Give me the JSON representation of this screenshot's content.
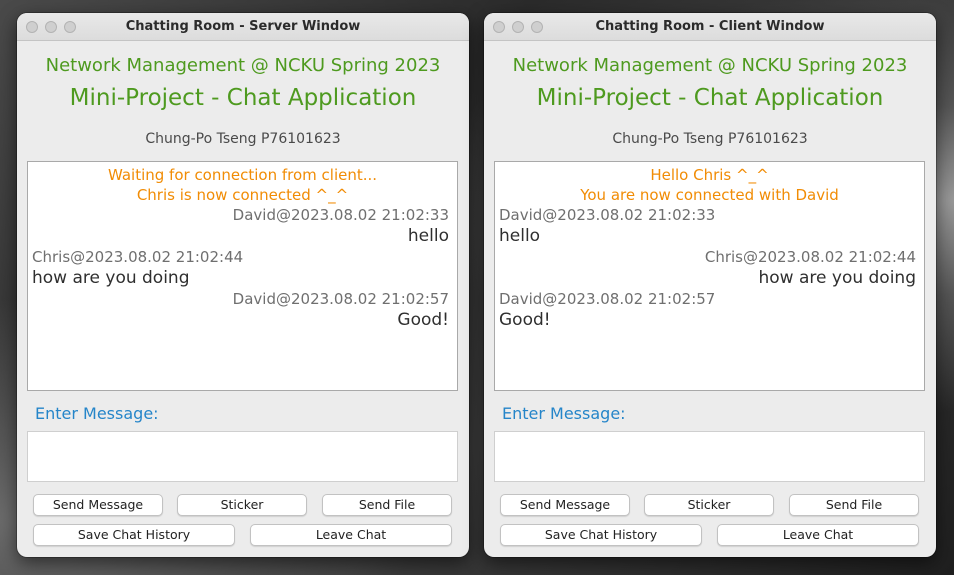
{
  "server": {
    "window_title": "Chatting Room - Server Window",
    "course": "Network Management @ NCKU Spring 2023",
    "project": "Mini-Project - Chat Application",
    "author": "Chung-Po Tseng P76101623",
    "system_messages": [
      "Waiting for connection from client...",
      "Chris is now connected ^_^"
    ],
    "messages": [
      {
        "header": "David@2023.08.02 21:02:33",
        "text": "hello"
      },
      {
        "header": "Chris@2023.08.02 21:02:44",
        "text": "how are you doing"
      },
      {
        "header": "David@2023.08.02 21:02:57",
        "text": "Good!"
      }
    ],
    "enter_label": "Enter Message:",
    "message_input_value": "",
    "buttons": {
      "send": "Send Message",
      "sticker": "Sticker",
      "file": "Send File",
      "save": "Save Chat History",
      "leave": "Leave Chat"
    }
  },
  "client": {
    "window_title": "Chatting Room - Client Window",
    "course": "Network Management @ NCKU Spring 2023",
    "project": "Mini-Project - Chat Application",
    "author": "Chung-Po Tseng P76101623",
    "system_messages": [
      "Hello Chris ^_^",
      "You are now connected with David"
    ],
    "messages": [
      {
        "header": "David@2023.08.02 21:02:33",
        "text": "hello"
      },
      {
        "header": "Chris@2023.08.02 21:02:44",
        "text": "how are you doing"
      },
      {
        "header": "David@2023.08.02 21:02:57",
        "text": "Good!"
      }
    ],
    "enter_label": "Enter Message:",
    "message_input_value": "",
    "buttons": {
      "send": "Send Message",
      "sticker": "Sticker",
      "file": "Send File",
      "save": "Save Chat History",
      "leave": "Leave Chat"
    }
  },
  "colors": {
    "heading_green": "#4e9a1f",
    "system_orange": "#f18c05",
    "label_blue": "#2585c9"
  }
}
